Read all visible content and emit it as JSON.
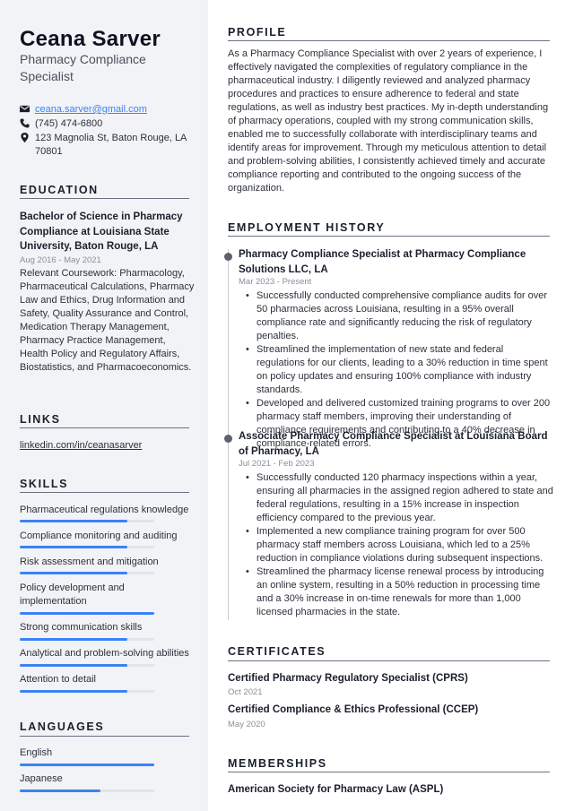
{
  "header": {
    "name": "Ceana Sarver",
    "job_title": "Pharmacy Compliance Specialist"
  },
  "contact": {
    "email": "ceana.sarver@gmail.com",
    "phone": "(745) 474-6800",
    "address": "123 Magnolia St, Baton Rouge, LA 70801",
    "icons": [
      "envelope-icon",
      "phone-icon",
      "map-pin-icon"
    ]
  },
  "education": {
    "title": "EDUCATION",
    "degree": "Bachelor of Science in Pharmacy Compliance at Louisiana State University, Baton Rouge, LA",
    "dates": "Aug 2016 - May 2021",
    "description": "Relevant Coursework: Pharmacology, Pharmaceutical Calculations, Pharmacy Law and Ethics, Drug Information and Safety, Quality Assurance and Control, Medication Therapy Management, Pharmacy Practice Management, Health Policy and Regulatory Affairs, Biostatistics, and Pharmacoeconomics."
  },
  "links": {
    "title": "LINKS",
    "items": [
      {
        "label": "linkedin.com/in/ceanasarver"
      }
    ]
  },
  "skills": {
    "title": "SKILLS",
    "items": [
      {
        "label": "Pharmaceutical regulations knowledge",
        "level": 0.8
      },
      {
        "label": "Compliance monitoring and auditing",
        "level": 0.8
      },
      {
        "label": "Risk assessment and mitigation",
        "level": 0.8
      },
      {
        "label": "Policy development and implementation",
        "level": 1.0
      },
      {
        "label": "Strong communication skills",
        "level": 0.8
      },
      {
        "label": "Analytical and problem-solving abilities",
        "level": 0.8
      },
      {
        "label": "Attention to detail",
        "level": 0.8
      }
    ]
  },
  "languages": {
    "title": "LANGUAGES",
    "items": [
      {
        "label": "English",
        "level": 1.0
      },
      {
        "label": "Japanese",
        "level": 0.6
      }
    ]
  },
  "profile": {
    "title": "PROFILE",
    "text": "As a Pharmacy Compliance Specialist with over 2 years of experience, I effectively navigated the complexities of regulatory compliance in the pharmaceutical industry. I diligently reviewed and analyzed pharmacy procedures and practices to ensure adherence to federal and state regulations, as well as industry best practices. My in-depth understanding of pharmacy operations, coupled with my strong communication skills, enabled me to successfully collaborate with interdisciplinary teams and identify areas for improvement. Through my meticulous attention to detail and problem-solving abilities, I consistently achieved timely and accurate compliance reporting and contributed to the ongoing success of the organization."
  },
  "employment": {
    "title": "EMPLOYMENT HISTORY",
    "jobs": [
      {
        "title": "Pharmacy Compliance Specialist at Pharmacy Compliance Solutions LLC, LA",
        "dates": "Mar 2023 - Present",
        "bullets": [
          "Successfully conducted comprehensive compliance audits for over 50 pharmacies across Louisiana, resulting in a 95% overall compliance rate and significantly reducing the risk of regulatory penalties.",
          "Streamlined the implementation of new state and federal regulations for our clients, leading to a 30% reduction in time spent on policy updates and ensuring 100% compliance with industry standards.",
          "Developed and delivered customized training programs to over 200 pharmacy staff members, improving their understanding of compliance requirements and contributing to a 40% decrease in compliance-related errors."
        ]
      },
      {
        "title": "Associate Pharmacy Compliance Specialist at Louisiana Board of Pharmacy, LA",
        "dates": "Jul 2021 - Feb 2023",
        "bullets": [
          "Successfully conducted 120 pharmacy inspections within a year, ensuring all pharmacies in the assigned region adhered to state and federal regulations, resulting in a 15% increase in inspection efficiency compared to the previous year.",
          "Implemented a new compliance training program for over 500 pharmacy staff members across Louisiana, which led to a 25% reduction in compliance violations during subsequent inspections.",
          "Streamlined the pharmacy license renewal process by introducing an online system, resulting in a 50% reduction in processing time and a 30% increase in on-time renewals for more than 1,000 licensed pharmacies in the state."
        ]
      }
    ]
  },
  "certificates": {
    "title": "CERTIFICATES",
    "items": [
      {
        "name": "Certified Pharmacy Regulatory Specialist (CPRS)",
        "date": "Oct 2021"
      },
      {
        "name": "Certified Compliance & Ethics Professional (CCEP)",
        "date": "May 2020"
      }
    ]
  },
  "memberships": {
    "title": "MEMBERSHIPS",
    "items": [
      {
        "name": "American Society for Pharmacy Law (ASPL)"
      }
    ]
  },
  "colors": {
    "accent": "#3b82f6",
    "sidebar_bg": "#f2f3f6",
    "text": "#2b303b",
    "muted": "#8a8f9a"
  }
}
